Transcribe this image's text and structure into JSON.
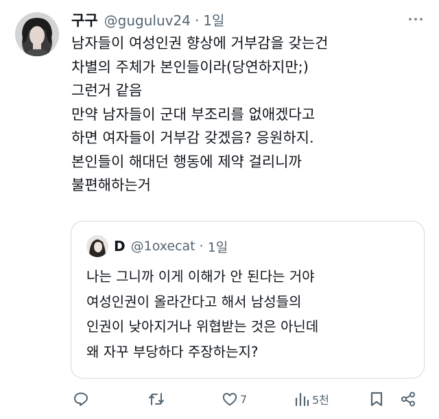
{
  "tweet": {
    "display_name": "구구",
    "handle": "@guguluv24",
    "separator": "·",
    "time": "1일",
    "lines": [
      "남자들이 여성인권 향상에 거부감을 갖는건",
      "차별의 주체가 본인들이라(당연하지만;)",
      "그런거 같음",
      "만약 남자들이 군대 부조리를 없애겠다고",
      "하면 여자들이 거부감 갖겠음? 응원하지.",
      "본인들이 해대던 행동에 제약 걸리니까",
      "불편해하는거"
    ]
  },
  "quote": {
    "display_name": "D",
    "handle": "@1oxecat",
    "separator": "·",
    "time": "1일",
    "lines": [
      "나는 그니까 이게 이해가 안 된다는 거야",
      "여성인권이 올라간다고 해서 남성들의",
      "인권이 낮아지거나 위협받는 것은 아닌데",
      "왜 자꾸 부당하다 주장하는지?"
    ]
  },
  "actions": {
    "reply_icon": "reply-icon",
    "retweet_icon": "retweet-icon",
    "like_icon": "like-icon",
    "like_count": "7",
    "views_icon": "views-icon",
    "views_count": "5천",
    "bookmark_icon": "bookmark-icon",
    "share_icon": "share-icon"
  },
  "colors": {
    "text": "#0f1419",
    "muted": "#536471",
    "border": "#cfd9de",
    "icon": "#536471"
  }
}
